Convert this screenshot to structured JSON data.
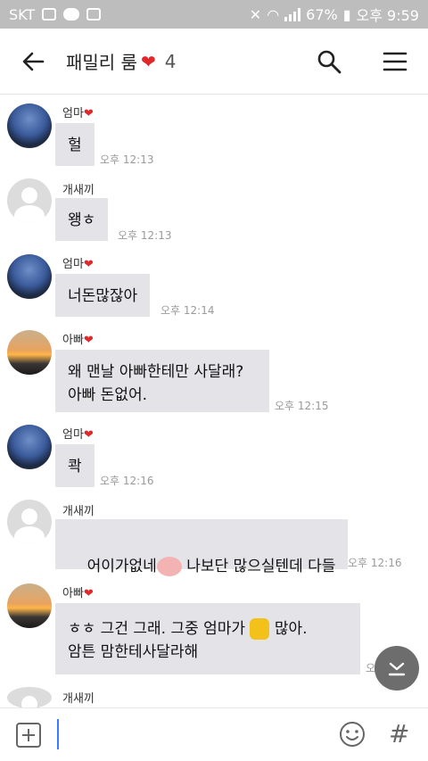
{
  "status_bar": {
    "carrier": "SKT",
    "battery": "67%",
    "time": "오후 9:59"
  },
  "header": {
    "title": "패밀리 룸",
    "title_heart": "❤",
    "member_count": "4",
    "icons": [
      "back-arrow-icon",
      "search-icon",
      "menu-icon"
    ]
  },
  "messages": [
    {
      "sender": "엄마",
      "heart": "❤",
      "text": "헐",
      "time": "오후 12:13",
      "avatar": "mom"
    },
    {
      "sender": "개새끼",
      "heart": "",
      "text": "왱ㅎ",
      "time": "오후 12:13",
      "avatar": "dog"
    },
    {
      "sender": "엄마",
      "heart": "❤",
      "text": "너돈많잖아",
      "time": "오후 12:14",
      "avatar": "mom"
    },
    {
      "sender": "아빠",
      "heart": "❤",
      "text": "왜 맨날 아빠한테만 사달래?\n아빠 돈없어.",
      "time": "오후 12:15",
      "avatar": "dad"
    },
    {
      "sender": "엄마",
      "heart": "❤",
      "text": "콱",
      "time": "오후 12:16",
      "avatar": "mom"
    },
    {
      "sender": "개새끼",
      "heart": "",
      "text_before": "어이가없네",
      "text_after": " 나보단 많으실텐데 다들",
      "time": "오후 12:16",
      "avatar": "dog"
    },
    {
      "sender": "아빠",
      "heart": "❤",
      "line1_before": "ㅎㅎ 그건 그래. 그중 엄마가 ",
      "line1_after": " 많아.",
      "line2": "암튼 맘한테사달라해",
      "time": "오후 12:17",
      "avatar": "dad"
    },
    {
      "sender": "개새끼",
      "heart": "",
      "avatar": "dog"
    }
  ],
  "colors": {
    "status_bar": "#bdbdbd",
    "bubble": "#e4e4e8",
    "heart": "#e0282a",
    "caret": "#3b7bff",
    "fab": "#6d6d6d"
  }
}
